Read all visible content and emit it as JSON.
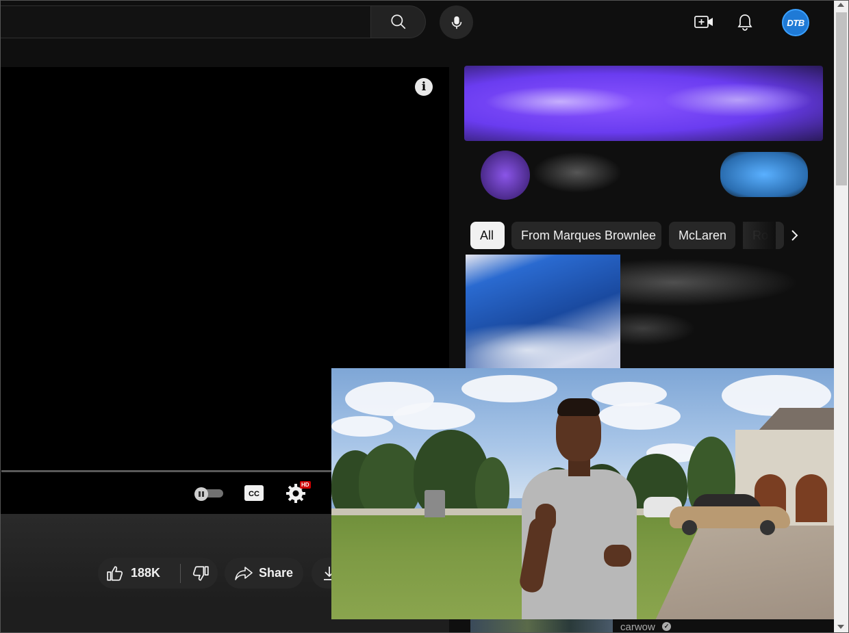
{
  "topbar": {
    "search_placeholder": "",
    "icons": [
      "search-icon",
      "microphone-icon",
      "create-video-icon",
      "notifications-bell-icon"
    ],
    "avatar_initials": "DTB"
  },
  "player": {
    "info_glyph": "i",
    "hd_badge": "HD",
    "cc_label": "CC"
  },
  "actions": {
    "like_count": "188K",
    "share_label": "Share"
  },
  "chips": [
    {
      "label": "All",
      "active": true
    },
    {
      "label": "From Marques Brownlee",
      "active": false
    },
    {
      "label": "McLaren",
      "active": false
    },
    {
      "label": "Ro",
      "active": false
    }
  ],
  "recommendation": {
    "channel_name": "carwow",
    "verified_glyph": "✓"
  },
  "colors": {
    "background": "#0f0f0f",
    "chip": "#272727",
    "chip_active": "#f1f1f1",
    "accent_red": "#cc0000",
    "avatar_blue": "#1f7ad6"
  }
}
